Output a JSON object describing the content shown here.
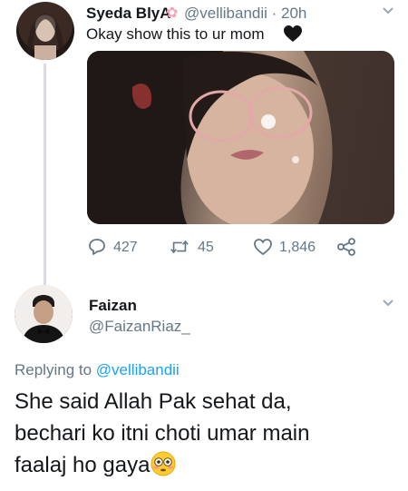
{
  "tweet1": {
    "display_name": "Syeda BlyA",
    "name_emoji": "cherry-blossom",
    "handle_time": "@vellibandii · 20h",
    "text": "Okay show this to ur mom",
    "text_emoji": "black-heart",
    "actions": {
      "reply_count": "427",
      "retweet_count": "45",
      "like_count": "1,846"
    }
  },
  "tweet2": {
    "display_name": "Faizan",
    "handle": "@FaizanRiaz_",
    "replying_prefix": "Replying to",
    "replying_to": "@vellibandii",
    "lines": [
      "She said Allah Pak sehat da,",
      "bechari ko itni choti umar main",
      "faalaj ho gaya"
    ],
    "end_emoji": "flushed-face"
  },
  "colors": {
    "text": "#14171a",
    "secondary": "#657786",
    "link": "#1da1f2",
    "thread_line": "#d9dde1"
  }
}
